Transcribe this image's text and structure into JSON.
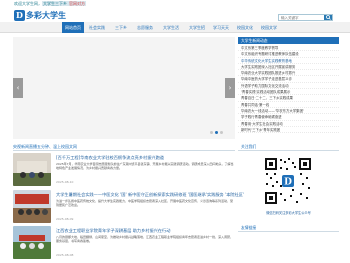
{
  "topbar": {
    "welcome_prefix": "欢迎大学生网，",
    "welcome_highlight1": "大学生三下乡",
    "welcome_highlight2": "官网对方"
  },
  "header": {
    "logo_mark": "D",
    "logo_text": "多彩大学生",
    "search_placeholder": "输入关键字"
  },
  "nav": {
    "items": [
      {
        "label": "网站首页",
        "active": true
      },
      {
        "label": "社会实践"
      },
      {
        "label": "三下乡"
      },
      {
        "label": "志愿服务"
      },
      {
        "label": "大学生活"
      },
      {
        "label": "大学生招"
      },
      {
        "label": "学习天天"
      },
      {
        "label": "校园文化"
      },
      {
        "label": "校园文学"
      }
    ]
  },
  "slider": {
    "prev": "‹",
    "next": "›",
    "dots": 3,
    "active_dot": 1
  },
  "sections": {
    "news_head": "央视新闻直播五分钟、温上校园文网"
  },
  "news": [
    {
      "title": "[百千万工程]华南农业大学驻校百舸争流点亮乡村振兴跑道",
      "desc": "2025年7月，华南农业大学百舸志愿服务队前往广东潮州饶平县钱东镇、开展乡村振兴实践调研活动。调研成员深入田间地头，了解当地特色产业发展情况，为乡村振兴贡献青春力量。",
      "date": "2025-08-10"
    },
    {
      "title": "大学生暑期社会实践——中医文化 '国' 新中医守正创新探索实践研修班 '国医继承'实践服务 '本院社区'",
      "desc": "为进一步弘扬中医药传统文化，提升大学生实践能力，中医学院组织志愿者深入社区，开展中医药文化宣传、义诊咨询等系列活动，受到居民广泛欢迎。",
      "date": "2025-08-09"
    },
    {
      "title": "江西农业工程职业学院青年学子深耕基层 助力乡村振兴在行动",
      "desc": "八月的赣鄱大地，稻田翻绿、山间夏至，为推动乡村振兴战略落地，江西农业工程职业学院组织青年志愿者走进乡村一线，深入调研，服务基层，书写青春答卷。",
      "date": "2025-08-08"
    }
  ],
  "notices": {
    "head": "大学生新闻动态",
    "items": [
      "中文系第三季度教学督导",
      "中文系组织专题研讨推进教师队伍建设",
      "中华传统文化大学生实践教育基地",
      "大学生实践团深入社区开展宣讲服务",
      "华南农业大学实践团队推进乡村振兴",
      "华南中医药大学学子走进基层义诊",
      "外语学子助力国际文化交流活动",
      "'青春实践'实践活动团队成果展示",
      "青春百日·二十二、三下乡实践成果",
      "青春共同话·第一线",
      "华南农大一线活动——'华农东方大学集团'",
      "学子践行青春使命砥砺奋进",
      "青春用·大学生社会实践活动",
      "新时代'三下乡'青年实践团"
    ]
  },
  "follow": {
    "head": "关注我们",
    "qr_caption": "微信扫码关注多彩大学生公众号",
    "qr_center": "D"
  },
  "links": {
    "head": "友情链接"
  },
  "colors": {
    "brand": "#1f6fb8",
    "nav_bg": "#f1f1f1"
  }
}
